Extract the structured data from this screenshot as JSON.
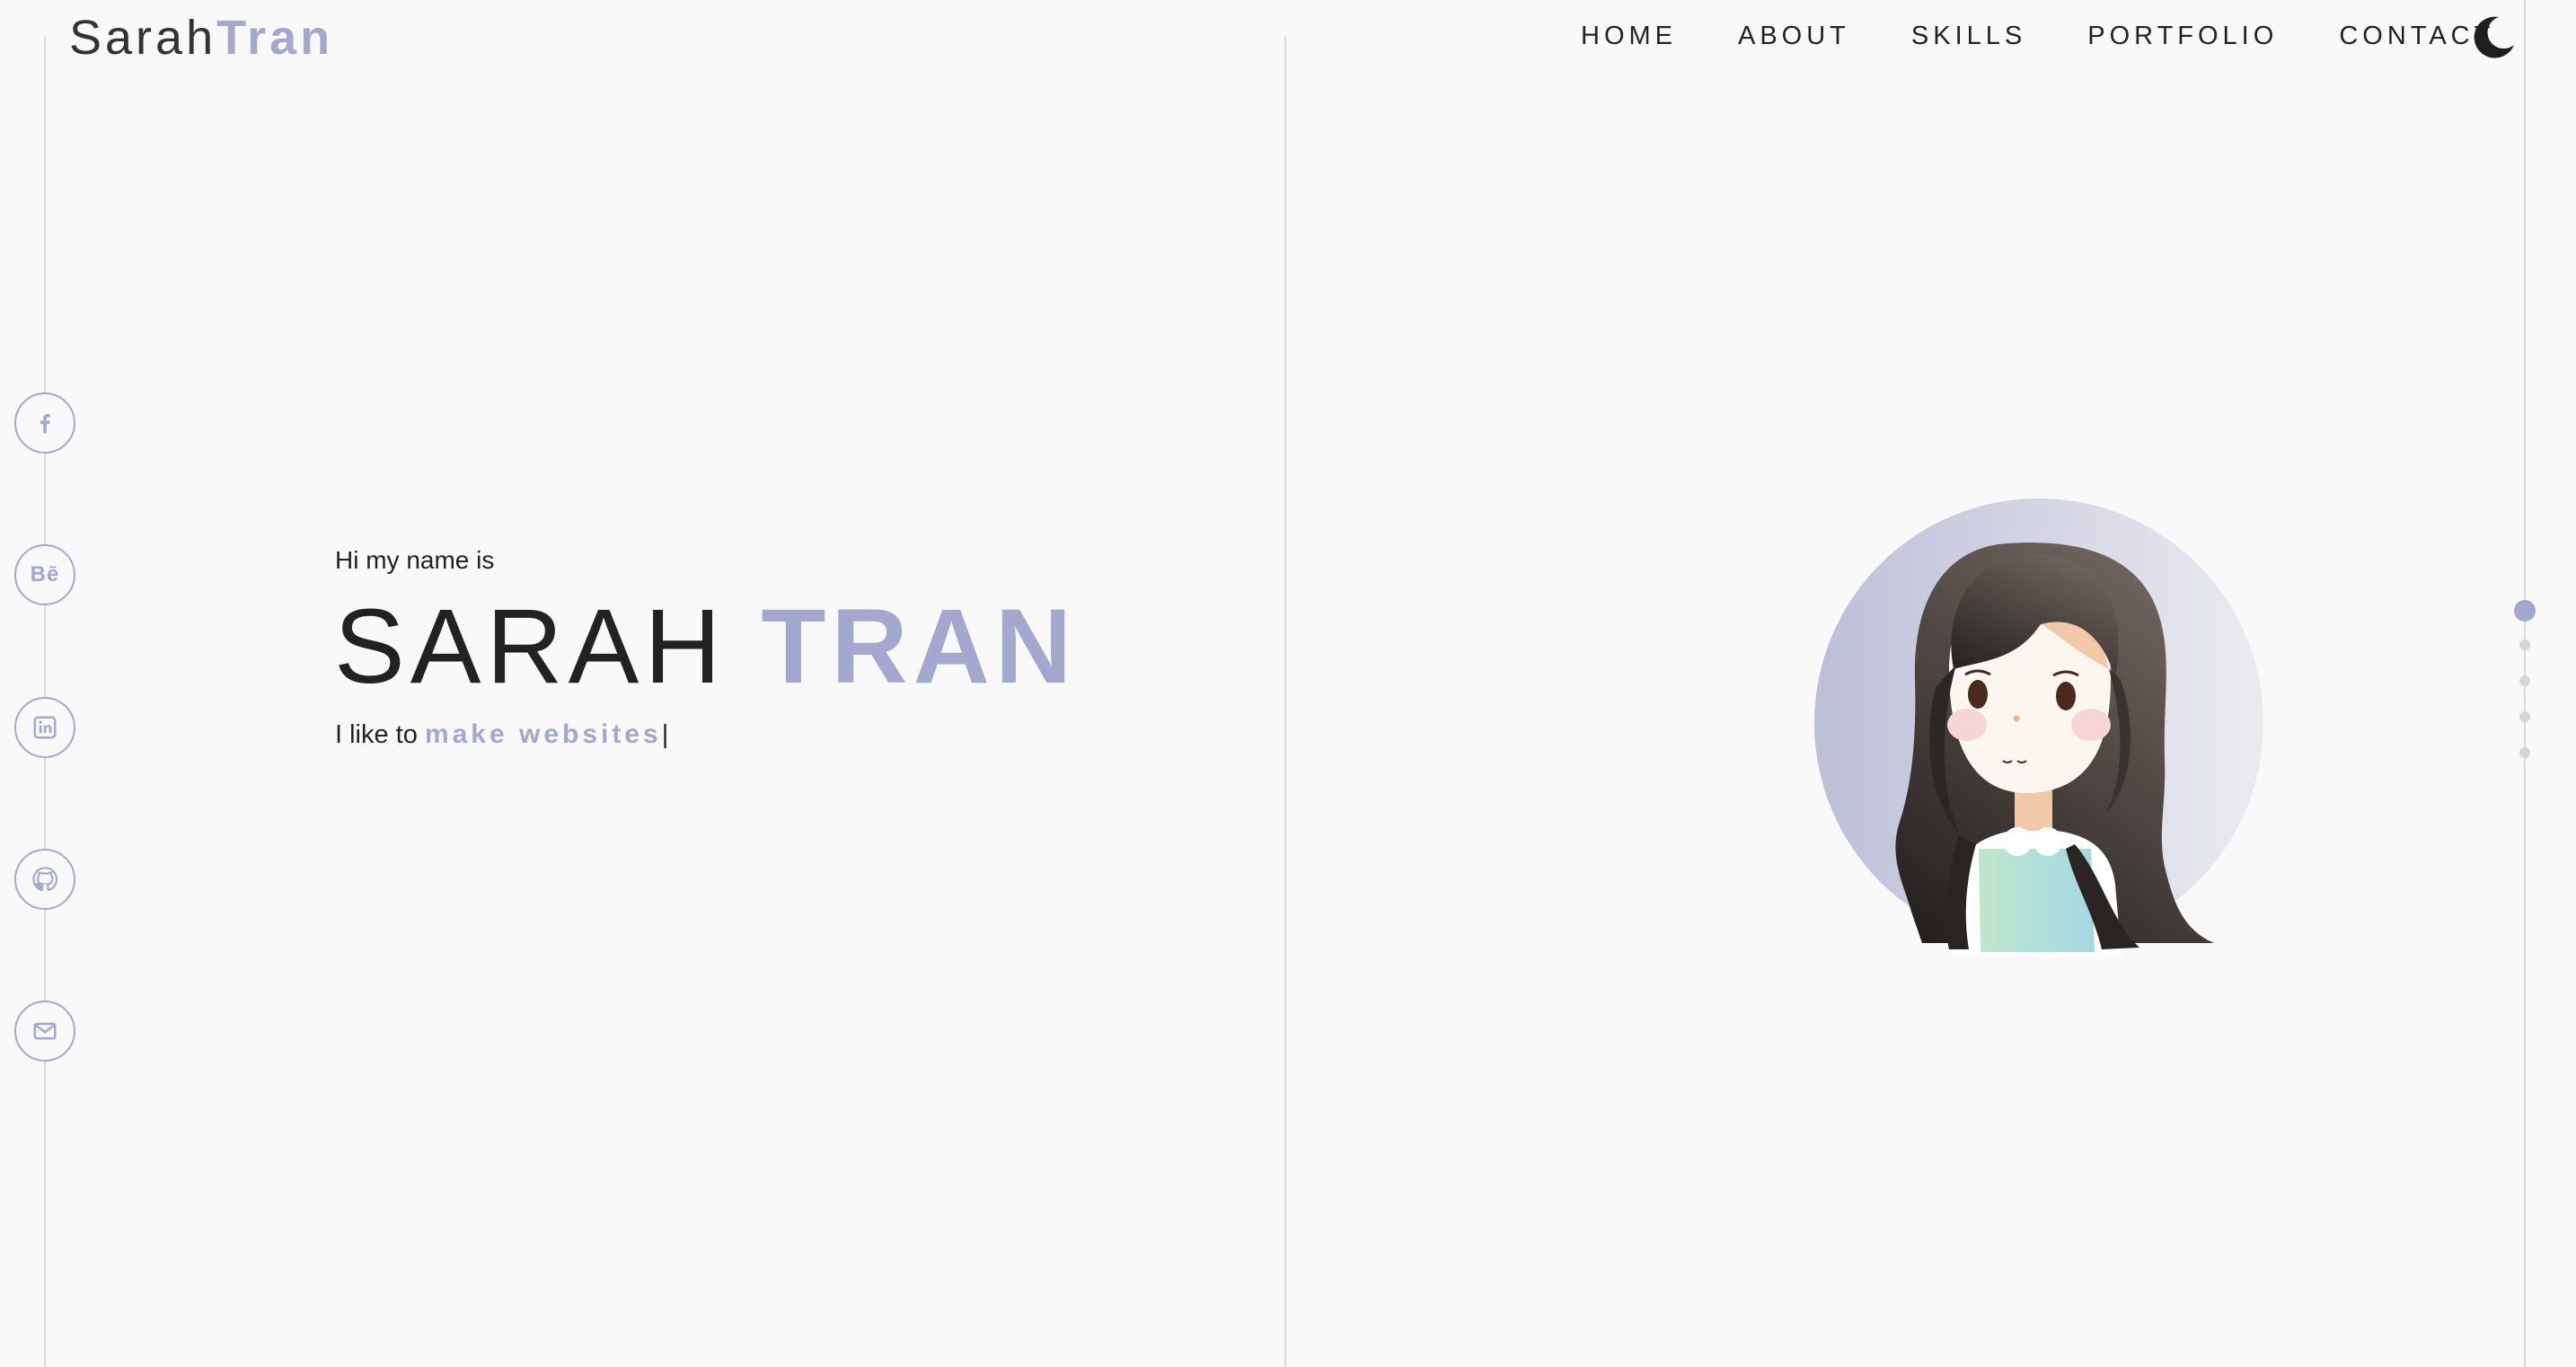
{
  "colors": {
    "accent": "#a4a8ce",
    "text": "#222222",
    "background": "#f9f9f9",
    "rail": "#dcdcdc"
  },
  "logo": {
    "first": "Sarah",
    "last": "Tran"
  },
  "nav": {
    "items": [
      {
        "label": "HOME"
      },
      {
        "label": "ABOUT"
      },
      {
        "label": "SKILLS"
      },
      {
        "label": "PORTFOLIO"
      },
      {
        "label": "CONTACT"
      }
    ],
    "theme_icon": "moon-icon"
  },
  "social": [
    {
      "icon": "facebook-icon"
    },
    {
      "icon": "behance-icon",
      "glyph": "Bē"
    },
    {
      "icon": "linkedin-icon"
    },
    {
      "icon": "github-icon"
    },
    {
      "icon": "mail-icon"
    }
  ],
  "hero": {
    "greeting": "Hi my name is",
    "first_name": "SARAH",
    "last_name": "TRAN",
    "tagline_prefix": "I like to",
    "tagline_typed": "make websites",
    "cursor": "|"
  },
  "section_dots": {
    "count": 5,
    "active_index": 0
  }
}
